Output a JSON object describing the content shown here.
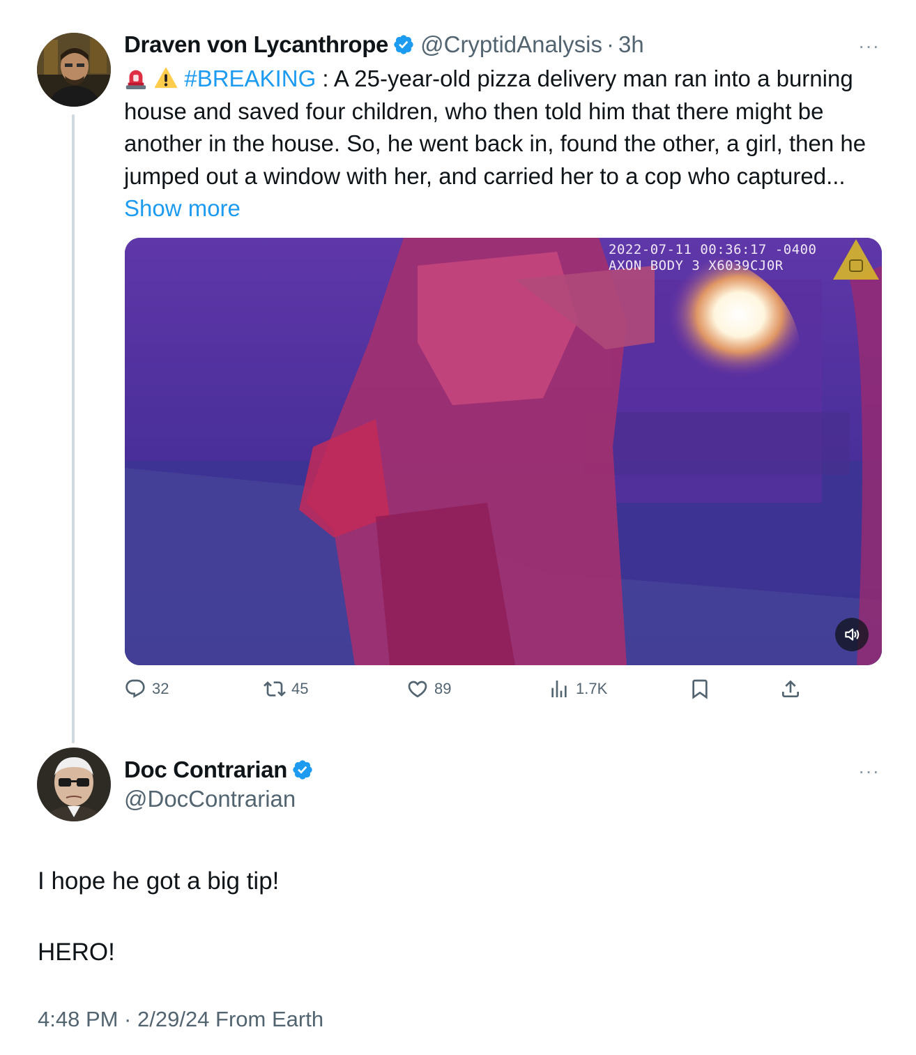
{
  "original_tweet": {
    "author_name": "Draven von Lycanthrope",
    "handle": "@CryptidAnalysis",
    "separator": "·",
    "time": "3h",
    "more": "···",
    "text_emoji": [
      "siren-emoji",
      "warning-emoji"
    ],
    "hashtag": "#BREAKING",
    "text_body": " : A 25-year-old pizza delivery man ran into a burning house and saved four children, who then told him that there might be another in the house. So, he went back in, found the other, a girl, then he jumped out a window with her, and carried her to a cop who captured...",
    "show_more": "Show more",
    "video": {
      "timestamp_line": "2022-07-11 00:36:17 -0400",
      "device_line": "AXON BODY 3 X6039CJ0R",
      "mute_icon": "speaker-muted-icon"
    },
    "actions": {
      "replies": "32",
      "reposts": "45",
      "likes": "89",
      "views": "1.7K"
    }
  },
  "reply_tweet": {
    "author_name": "Doc Contrarian",
    "handle": "@DocContrarian",
    "more": "···",
    "line1": "I hope he got a big tip!",
    "line2": "HERO!",
    "meta": "4:48 PM · 2/29/24 From Earth"
  },
  "colors": {
    "link": "#1d9bf0",
    "secondary_text": "#536471",
    "thread_line": "#cfd9de",
    "verified": "#1d9bf0"
  }
}
